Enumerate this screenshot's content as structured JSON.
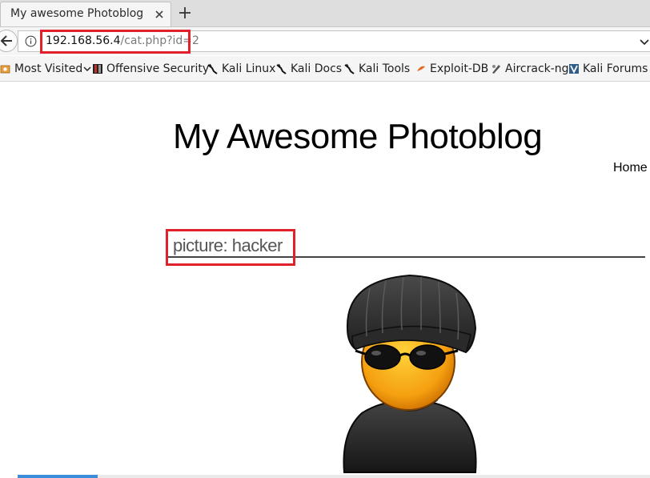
{
  "browser": {
    "tab_title": "My awesome Photoblog",
    "url_host": "192.168.56.4",
    "url_path": "/cat.php?id=2"
  },
  "bookmarks": [
    {
      "label": "Most Visited",
      "icon": "gear-icon"
    },
    {
      "label": "Offensive Security",
      "icon": "offsec-icon"
    },
    {
      "label": "Kali Linux",
      "icon": "kali-dragon-icon"
    },
    {
      "label": "Kali Docs",
      "icon": "kali-dragon-icon"
    },
    {
      "label": "Kali Tools",
      "icon": "kali-dragon-icon"
    },
    {
      "label": "Exploit-DB",
      "icon": "exploitdb-icon"
    },
    {
      "label": "Aircrack-ng",
      "icon": "aircrack-icon"
    },
    {
      "label": "Kali Forums",
      "icon": "kali-forums-icon"
    }
  ],
  "page": {
    "title": "My Awesome Photoblog",
    "nav_home": "Home",
    "picture_caption": "picture: hacker",
    "picture_subject": "hacker-avatar"
  },
  "colors": {
    "highlight": "#e0202a",
    "title_text": "#000000",
    "caption_text": "#555555"
  }
}
